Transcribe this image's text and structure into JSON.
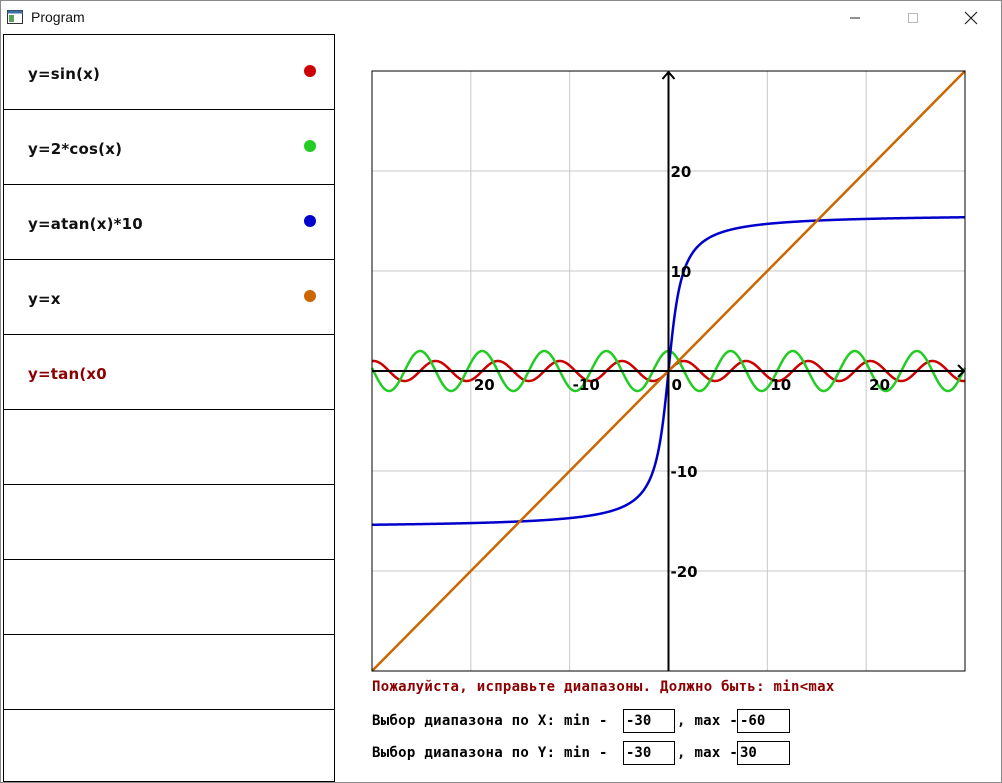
{
  "window": {
    "title": "Program"
  },
  "functions": [
    {
      "label": "y=sin(x)",
      "color": "#cc0000",
      "active": false
    },
    {
      "label": "y=2*cos(x)",
      "color": "#22cc22",
      "active": false
    },
    {
      "label": "y=atan(x)*10",
      "color": "#0000cc",
      "active": false
    },
    {
      "label": "y=x",
      "color": "#cc6600",
      "active": false
    },
    {
      "label": "y=tan(x0",
      "color": "#8b0000",
      "active": true,
      "invalid": true
    },
    {
      "label": ""
    },
    {
      "label": ""
    },
    {
      "label": ""
    },
    {
      "label": ""
    }
  ],
  "chart_data": {
    "type": "line",
    "xlim": [
      -30,
      30
    ],
    "ylim": [
      -30,
      30
    ],
    "grid": true,
    "x_ticks": [
      -20,
      -10,
      0,
      10,
      20
    ],
    "y_ticks": [
      -20,
      -10,
      10,
      20
    ],
    "x_tick_labels": [
      "20",
      "-10",
      "0",
      "10",
      "20"
    ],
    "y_tick_labels": [
      "-20",
      "-10",
      "10",
      "20"
    ],
    "series": [
      {
        "name": "y=sin(x)",
        "expr": "sin",
        "color": "#cc0000"
      },
      {
        "name": "y=2*cos(x)",
        "expr": "2cos",
        "color": "#22cc22"
      },
      {
        "name": "y=atan(x)*10",
        "expr": "atan10",
        "color": "#0000cc"
      },
      {
        "name": "y=x",
        "expr": "identity",
        "color": "#cc6600"
      }
    ]
  },
  "error": {
    "message": "Пожалуйста, исправьте диапазоны. Должно быть: min<max"
  },
  "range_x": {
    "label": "Выбор диапазона по X: min -",
    "min": "-30",
    "max_label": ", max -",
    "max": "-60"
  },
  "range_y": {
    "label": "Выбор диапазона по Y: min -",
    "min": "-30",
    "max_label": ", max -",
    "max": "30"
  }
}
